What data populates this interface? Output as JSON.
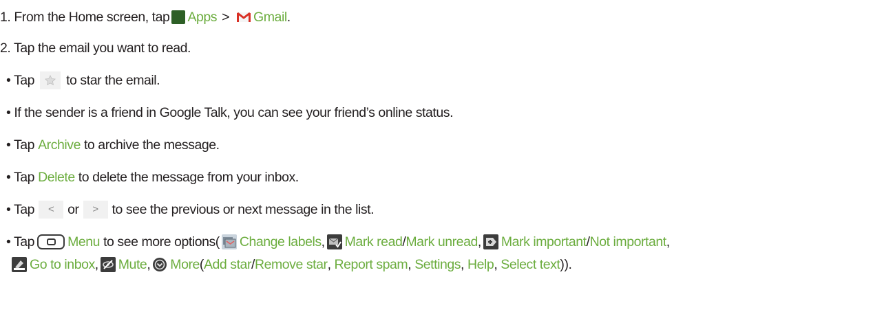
{
  "steps": {
    "step1": {
      "prefix": "1. From the Home screen, tap",
      "apps_label": "Apps",
      "separator": ">",
      "gmail_label": "Gmail",
      "end": "."
    },
    "step2": {
      "text": "2. Tap the email you want to read."
    }
  },
  "bullets": {
    "star": {
      "tap": "• Tap",
      "rest": "to star the email."
    },
    "status": {
      "text": "• If the sender is a friend in Google Talk, you can see your friend’s online status."
    },
    "archive": {
      "tap": "• Tap",
      "link": "Archive",
      "rest": "to archive the message."
    },
    "delete": {
      "tap": "• Tap",
      "link": "Delete",
      "rest": "to delete the message from your inbox."
    },
    "navigate": {
      "tap": "• Tap",
      "or": "or",
      "rest": "to see the previous or next message in the list.",
      "prev_glyph": "<",
      "next_glyph": ">"
    },
    "menu": {
      "tap": "• Tap",
      "menu_link": "Menu",
      "mid": "to see more options(",
      "change_labels": "Change labels",
      "comma1": ",",
      "mark_read": "Mark read",
      "slash1": "/",
      "mark_unread": "Mark unread",
      "comma2": ",",
      "mark_important": "Mark important",
      "slash2": "/",
      "not_important": "Not important",
      "comma3": ",",
      "go_to_inbox": "Go to inbox",
      "comma4": ",",
      "mute": "Mute",
      "comma5": ",",
      "more": "More",
      "open_paren": "(",
      "add_star": "Add star",
      "slash3": "/",
      "remove_star": "Remove star",
      "comma6": ",",
      "report_spam": "Report spam",
      "comma7": ",",
      "settings": "Settings",
      "comma8": ",",
      "help": "Help",
      "comma9": ",",
      "select_text": "Select text",
      "close": "))."
    }
  },
  "icons": {
    "apps": "apps-grid-icon",
    "gmail": "gmail-icon",
    "star": "star-icon",
    "prev": "chevron-left-icon",
    "next": "chevron-right-icon",
    "menu_key": "menu-key-icon",
    "change_labels": "change-labels-icon",
    "mark_read": "mark-read-icon",
    "mark_important": "mark-important-icon",
    "go_to_inbox": "go-to-inbox-icon",
    "mute": "mute-icon",
    "more": "more-icon"
  },
  "colors": {
    "link": "#6cad3f",
    "text": "#231f20"
  }
}
